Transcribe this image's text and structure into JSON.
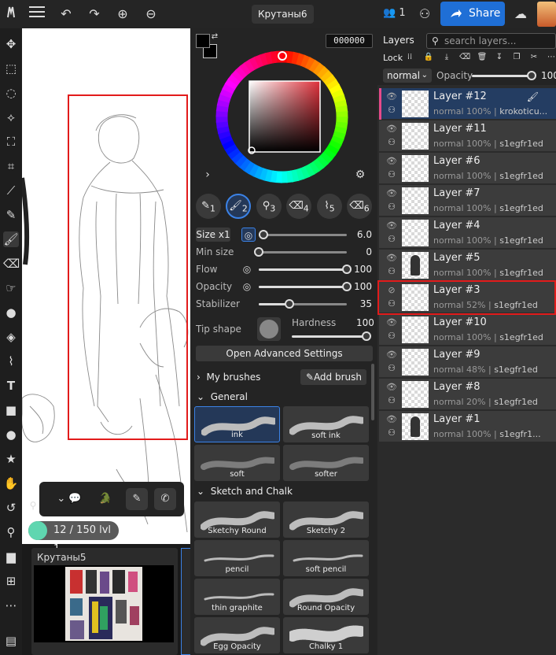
{
  "topbar": {
    "doc_title": "Крутаны6",
    "users_count": "1",
    "share_label": "Share"
  },
  "color": {
    "hex": "000000",
    "primary": "#000000",
    "secondary": "#000000"
  },
  "brush_presets": [
    "1",
    "2",
    "3",
    "4",
    "5",
    "6"
  ],
  "size_label": "Size x1",
  "sliders": [
    {
      "label": "",
      "value": "6.0",
      "level": 0.05
    },
    {
      "label": "Min size",
      "value": "0",
      "level": 0
    },
    {
      "label": "Flow",
      "value": "100",
      "level": 1
    },
    {
      "label": "Opacity",
      "value": "100",
      "level": 1
    },
    {
      "label": "Stabilizer",
      "value": "35",
      "level": 0.35
    }
  ],
  "tip_shape_label": "Tip shape",
  "hardness": {
    "label": "Hardness",
    "value": "100",
    "level": 1
  },
  "advanced_label": "Open Advanced Settings",
  "my_brushes_label": "My brushes",
  "add_brush_label": "Add brush",
  "sections": {
    "general": "General",
    "sketch": "Sketch and Chalk"
  },
  "brushes_general": [
    "ink",
    "soft ink",
    "soft",
    "softer"
  ],
  "brushes_sketch": [
    "Sketchy Round",
    "Sketchy 2",
    "pencil",
    "soft pencil",
    "thin graphite",
    "Round Opacity",
    "Egg Opacity",
    "Chalky 1"
  ],
  "canvas": {
    "level_text": "12 / 150  lvl 1"
  },
  "thumb": {
    "title": "Крутаны5"
  },
  "layers_panel": {
    "tab": "Layers",
    "search_placeholder": "search layers...",
    "lock_label": "Lock",
    "blend": "normal",
    "opacity_label": "Opacity",
    "opacity_value": "100"
  },
  "layers": [
    {
      "name": "Layer #12",
      "mode": "normal",
      "opacity": "100%",
      "owner": "krokoticu..."
    },
    {
      "name": "Layer #11",
      "mode": "normal",
      "opacity": "100%",
      "owner": "s1egfr1ed"
    },
    {
      "name": "Layer #6",
      "mode": "normal",
      "opacity": "100%",
      "owner": "s1egfr1ed"
    },
    {
      "name": "Layer #7",
      "mode": "normal",
      "opacity": "100%",
      "owner": "s1egfr1ed"
    },
    {
      "name": "Layer #4",
      "mode": "normal",
      "opacity": "100%",
      "owner": "s1egfr1ed"
    },
    {
      "name": "Layer #5",
      "mode": "normal",
      "opacity": "100%",
      "owner": "s1egfr1ed"
    },
    {
      "name": "Layer #3",
      "mode": "normal",
      "opacity": "52%",
      "owner": "s1egfr1ed"
    },
    {
      "name": "Layer #10",
      "mode": "normal",
      "opacity": "100%",
      "owner": "s1egfr1ed"
    },
    {
      "name": "Layer #9",
      "mode": "normal",
      "opacity": "48%",
      "owner": "s1egfr1ed"
    },
    {
      "name": "Layer #8",
      "mode": "normal",
      "opacity": "20%",
      "owner": "s1egfr1ed"
    },
    {
      "name": "Layer #1",
      "mode": "normal",
      "opacity": "100%",
      "owner": "s1egfr1..."
    }
  ],
  "icons": {
    "left_tools": [
      "move-icon",
      "marquee-icon",
      "lasso-icon",
      "lasso-poly-icon",
      "transform-icon",
      "crop-icon",
      "eyedropper-icon",
      "pencil-icon",
      "brush-icon",
      "eraser-icon",
      "smudge-icon",
      "blur-icon",
      "fill-icon",
      "selection-brush-icon",
      "text-icon",
      "rectangle-icon",
      "ellipse-icon",
      "star-icon",
      "hand-icon",
      "rotate-icon",
      "zoom-icon",
      "chat-icon",
      "grid-icon",
      "more-icon",
      "filmstrip-icon"
    ]
  }
}
